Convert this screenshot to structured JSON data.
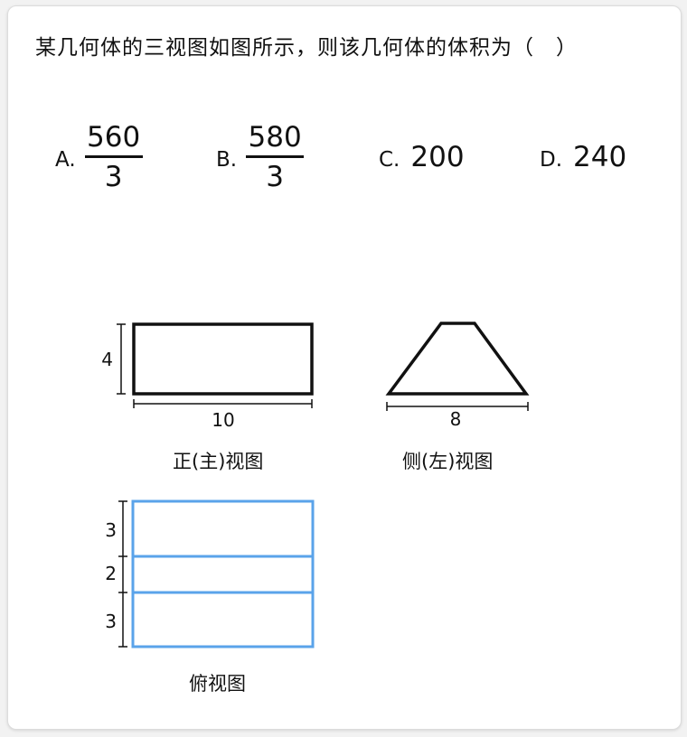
{
  "question": "某几何体的三视图如图所示，则该几何体的体积为（　）",
  "options": [
    {
      "letter": "A.",
      "numerator": "560",
      "denominator": "3"
    },
    {
      "letter": "B.",
      "numerator": "580",
      "denominator": "3"
    },
    {
      "letter": "C.",
      "value": "200"
    },
    {
      "letter": "D.",
      "value": "240"
    }
  ],
  "front_view": {
    "label": "正(主)视图",
    "height": "4",
    "width": "10"
  },
  "side_view": {
    "label": "侧(左)视图",
    "width": "8"
  },
  "top_view": {
    "label": "俯视图",
    "dims": [
      "3",
      "2",
      "3"
    ]
  },
  "colors": {
    "outline": "#111111",
    "top_view_outline": "#5aa3ea"
  }
}
